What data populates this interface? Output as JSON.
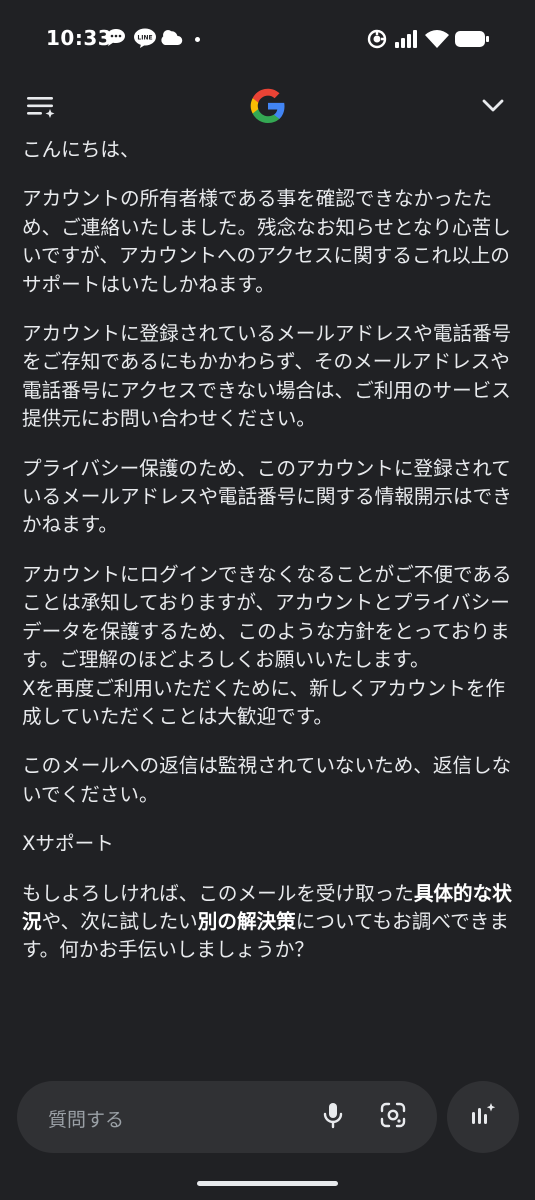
{
  "status_bar": {
    "time": "10:33",
    "left_icons": [
      "chat-bubble-icon",
      "line-app-icon",
      "cloud-icon",
      "notification-dot"
    ],
    "right_icons": [
      "vpn-icon",
      "signal-icon",
      "wifi-icon",
      "battery-icon"
    ]
  },
  "header": {
    "left_icon": "chat-history-icon",
    "logo": "google-g-logo",
    "right_icon": "chevron-down-icon"
  },
  "message": {
    "p1": "こんにちは、",
    "p2": "アカウントの所有者様である事を確認できなかったため、ご連絡いたしました。残念なお知らせとなり心苦しいですが、アカウントへのアクセスに関するこれ以上のサポートはいたしかねます。",
    "p3": "アカウントに登録されているメールアドレスや電話番号をご存知であるにもかかわらず、そのメールアドレスや電話番号にアクセスできない場合は、ご利用のサービス提供元にお問い合わせください。",
    "p4": "プライバシー保護のため、このアカウントに登録されているメールアドレスや電話番号に関する情報開示はできかねます。",
    "p5": "アカウントにログインできなくなることがご不便であることは承知しておりますが、アカウントとプライバシーデータを保護するため、このような方針をとっております。ご理解のほどよろしくお願いいたします。",
    "p5b": "Xを再度ご利用いただくために、新しくアカウントを作成していただくことは大歓迎です。",
    "p6": "このメールへの返信は監視されていないため、返信しないでください。",
    "p7": "Xサポート",
    "follow_up": {
      "s1": "もしよろしければ、このメールを受け取った",
      "b1": "具体的な状況",
      "s2": "や、次に試したい",
      "b2": "別の解決策",
      "s3": "についてもお調べできます。何かお手伝いしましょうか？"
    }
  },
  "input": {
    "placeholder": "質問する",
    "mic_icon": "mic-icon",
    "lens_icon": "google-lens-icon",
    "live_icon": "gemini-live-icon"
  },
  "colors": {
    "background": "#202124",
    "surface": "#303134",
    "text": "#e8eaed",
    "placeholder": "#9aa0a6"
  }
}
